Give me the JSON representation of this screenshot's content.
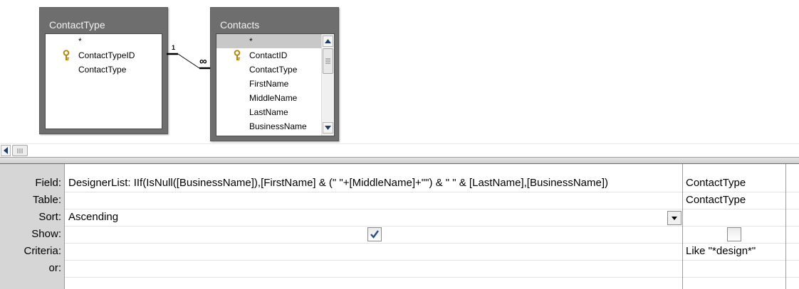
{
  "tables": [
    {
      "title": "ContactType",
      "fields": [
        "*",
        "ContactTypeID",
        "ContactType"
      ],
      "primary_key_index": 1
    },
    {
      "title": "Contacts",
      "fields": [
        "*",
        "ContactID",
        "ContactType",
        "FirstName",
        "MiddleName",
        "LastName",
        "BusinessName"
      ],
      "primary_key_index": 1,
      "selected_index": 0
    }
  ],
  "relationship": {
    "one_side": "1",
    "many_side": "∞"
  },
  "grid": {
    "row_labels": [
      "Field:",
      "Table:",
      "Sort:",
      "Show:",
      "Criteria:",
      "or:"
    ],
    "columns": [
      {
        "field": "DesignerList: IIf(IsNull([BusinessName]),[FirstName] & (\" \"+[MiddleName]+\"\") & \" \" & [LastName],[BusinessName])",
        "table": "",
        "sort": "Ascending",
        "show": true,
        "criteria": "",
        "or": ""
      },
      {
        "field": "ContactType",
        "table": "ContactType",
        "sort": "",
        "show": false,
        "criteria": "Like \"*design*\"",
        "or": ""
      }
    ]
  },
  "icons": [
    "key-icon",
    "scroll-up-arrow-icon",
    "scroll-down-arrow-icon",
    "scroll-left-arrow-icon",
    "dropdown-arrow-icon",
    "checkmark-icon"
  ],
  "colors": {
    "table_frame": "#6e6e6e",
    "row_header": "#d6d6d6",
    "selected_field": "#c8c8c8"
  }
}
